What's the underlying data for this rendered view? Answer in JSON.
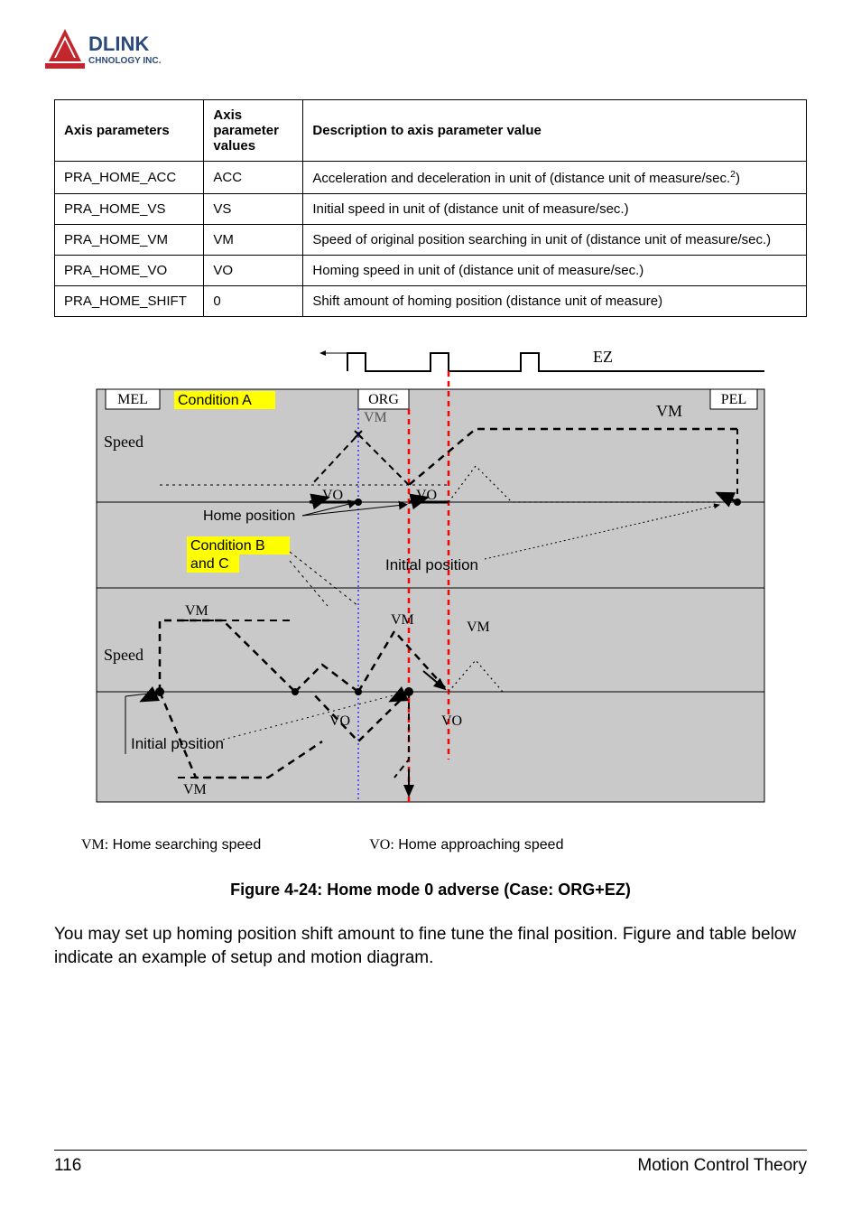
{
  "logo": {
    "brand_top": "DLINK",
    "brand_bottom": "CHNOLOGY INC."
  },
  "table": {
    "headers": [
      "Axis parameters",
      "Axis parameter values",
      "Description to axis parameter value"
    ],
    "rows": [
      {
        "p": "PRA_HOME_ACC",
        "v": "ACC",
        "d_pre": "Acceleration and deceleration in unit of (distance unit of measure/sec.",
        "d_sup": "2",
        "d_post": ")"
      },
      {
        "p": "PRA_HOME_VS",
        "v": "VS",
        "d_pre": "Initial speed in unit of (distance unit of measure/sec.)",
        "d_sup": "",
        "d_post": ""
      },
      {
        "p": "PRA_HOME_VM",
        "v": "VM",
        "d_pre": "Speed of original position searching in unit of (distance unit of measure/sec.)",
        "d_sup": "",
        "d_post": ""
      },
      {
        "p": "PRA_HOME_VO",
        "v": "VO",
        "d_pre": "Homing speed in unit of (distance unit of measure/sec.)",
        "d_sup": "",
        "d_post": ""
      },
      {
        "p": "PRA_HOME_SHIFT",
        "v": "0",
        "d_pre": "Shift amount of homing position (distance unit of measure)",
        "d_sup": "",
        "d_post": ""
      }
    ]
  },
  "diagram": {
    "ez": "EZ",
    "mel": "MEL",
    "org": "ORG",
    "pel": "PEL",
    "condA": "Condition A",
    "condBC_l1": "Condition B",
    "condBC_l2": "and C",
    "speed": "Speed",
    "home_pos": "Home position",
    "init_pos": "Initial position",
    "vm": "VM",
    "vo": "VO"
  },
  "legend": {
    "vm_sym": "VM:",
    "vm_txt": " Home searching speed",
    "vo_sym": "VO:",
    "vo_txt": " Home approaching speed"
  },
  "caption": "Figure 4-24: Home mode 0 adverse (Case:  ORG+EZ)",
  "body": "You may set up homing position shift amount to fine tune the final position. Figure and table below indicate an example of setup and motion diagram.",
  "footer": {
    "page": "116",
    "section": "Motion Control Theory"
  }
}
